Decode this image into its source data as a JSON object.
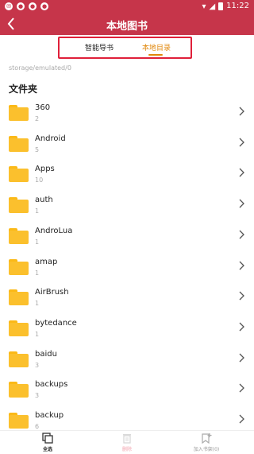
{
  "status_bar": {
    "time": "11:22",
    "notification_icons": [
      "mail-icon",
      "app-icon",
      "app-icon",
      "app-icon"
    ]
  },
  "navbar": {
    "title": "本地图书",
    "back_icon": "back-arrow-icon"
  },
  "tabs": [
    {
      "label": "智能导书",
      "active": false
    },
    {
      "label": "本地目录",
      "active": true
    }
  ],
  "path": "storage/emulated/0",
  "section_title": "文件夹",
  "folders": [
    {
      "name": "360",
      "count": "2"
    },
    {
      "name": "Android",
      "count": "5"
    },
    {
      "name": "Apps",
      "count": "10"
    },
    {
      "name": "auth",
      "count": "1"
    },
    {
      "name": "AndroLua",
      "count": "1"
    },
    {
      "name": "amap",
      "count": "1"
    },
    {
      "name": "AirBrush",
      "count": "1"
    },
    {
      "name": "bytedance",
      "count": "1"
    },
    {
      "name": "baidu",
      "count": "3"
    },
    {
      "name": "backups",
      "count": "3"
    },
    {
      "name": "backup",
      "count": "6"
    }
  ],
  "bottom_bar": {
    "select_all": "全选",
    "delete": "删除",
    "add_shelf": "加入书架(0)"
  },
  "colors": {
    "header": "#c6354a",
    "active_tab": "#e0870a",
    "folder": "#fbc02d"
  }
}
